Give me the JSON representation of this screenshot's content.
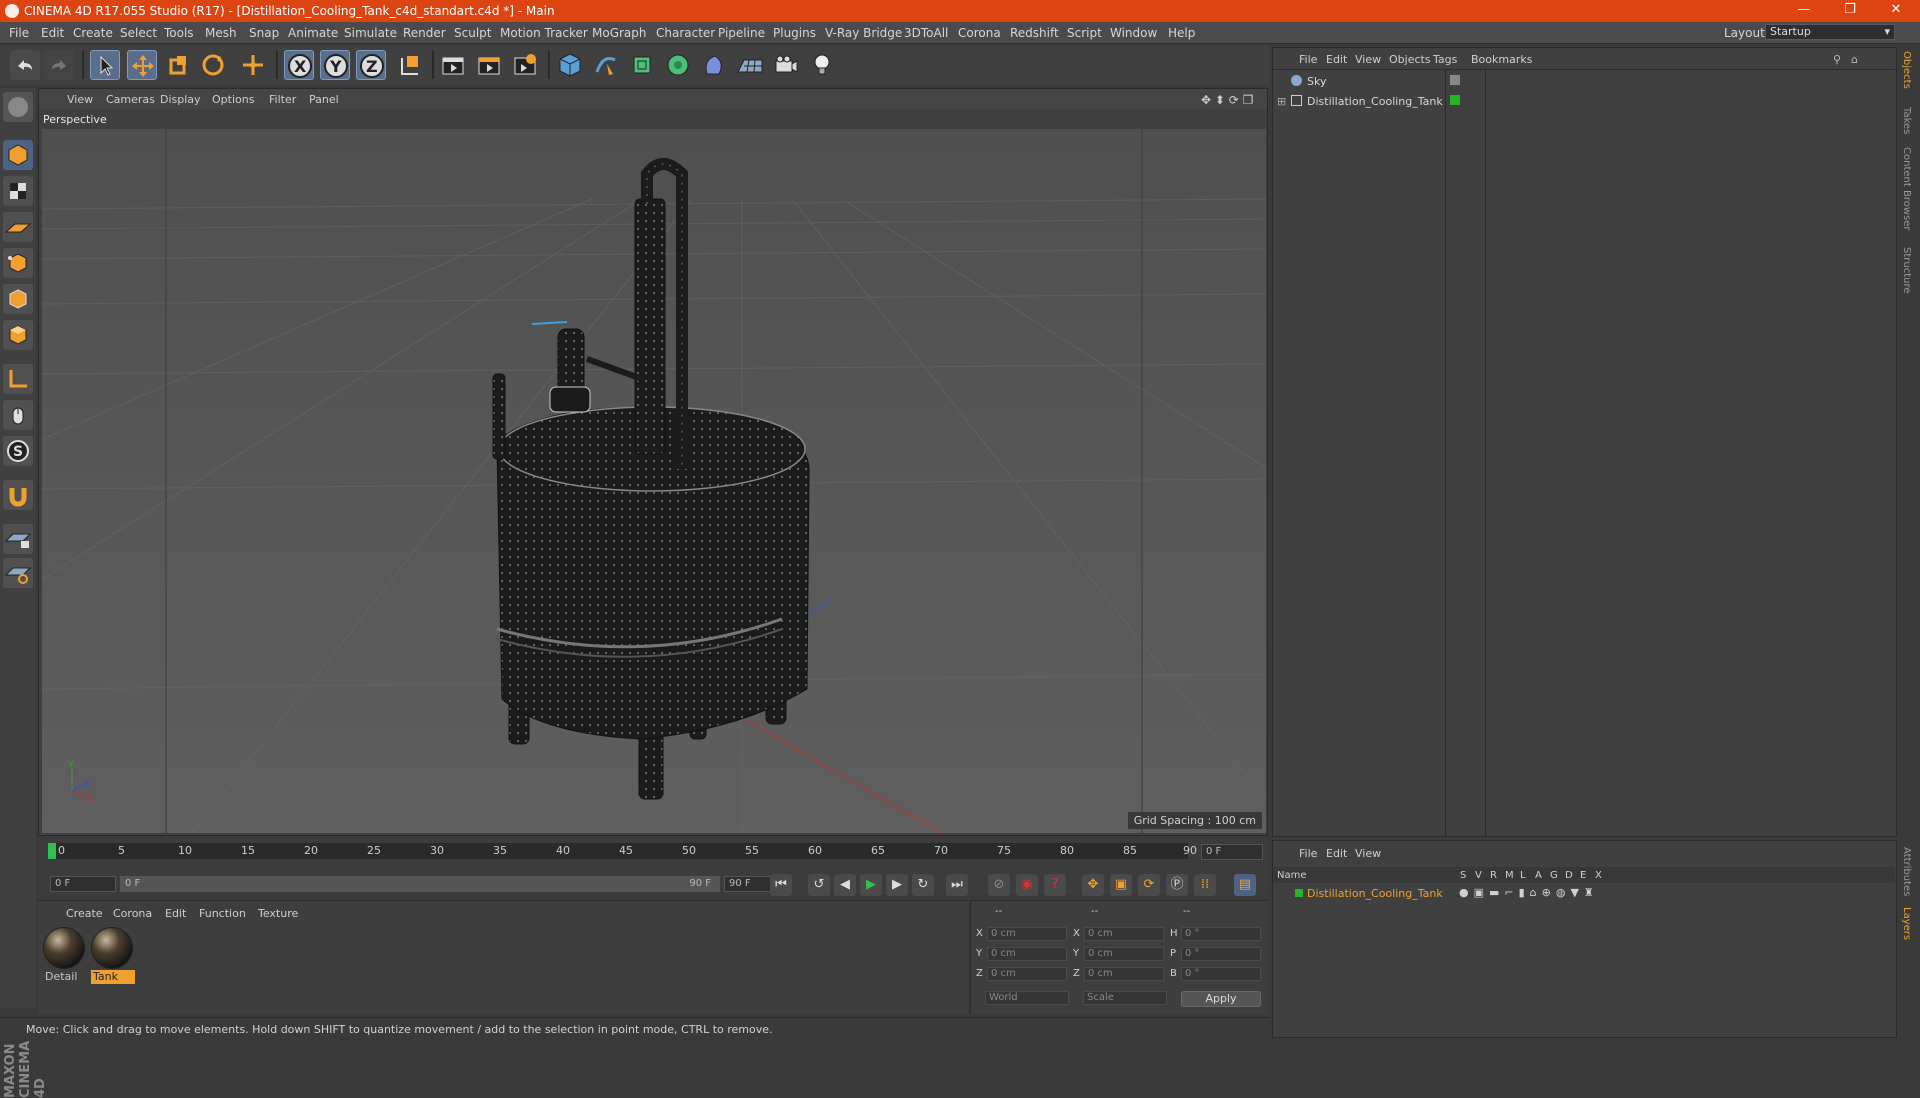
{
  "window": {
    "title": "CINEMA 4D R17.055 Studio (R17) - [Distillation_Cooling_Tank_c4d_standart.c4d *] - Main",
    "minimize": "—",
    "restore": "❐",
    "close": "✕"
  },
  "menu": [
    "File",
    "Edit",
    "Create",
    "Select",
    "Tools",
    "Mesh",
    "Snap",
    "Animate",
    "Simulate",
    "Render",
    "Sculpt",
    "Motion Tracker",
    "MoGraph",
    "Character",
    "Pipeline",
    "Plugins",
    "V-Ray Bridge",
    "3DToAll",
    "Corona",
    "Redshift",
    "Script",
    "Window",
    "Help"
  ],
  "layout": {
    "label": "Layout:",
    "value": "Startup"
  },
  "viewport": {
    "menu": [
      "View",
      "Cameras",
      "Display",
      "Options",
      "Filter",
      "Panel"
    ],
    "camera": "Perspective",
    "grid_spacing": "Grid Spacing : 100 cm"
  },
  "timeline": {
    "ticks": [
      "0",
      "5",
      "10",
      "15",
      "20",
      "25",
      "30",
      "35",
      "40",
      "45",
      "50",
      "55",
      "60",
      "65",
      "70",
      "75",
      "80",
      "85",
      "90"
    ],
    "current_frame": "0 F",
    "start": "0 F",
    "range_start": "0 F",
    "range_end": "90 F",
    "end": "90 F"
  },
  "materials": {
    "menu": [
      "Create",
      "Corona",
      "Edit",
      "Function",
      "Texture"
    ],
    "items": [
      {
        "name": "Detail",
        "selected": false
      },
      {
        "name": "Tank",
        "selected": true
      }
    ]
  },
  "coords": {
    "headers": [
      "--",
      "--",
      "--"
    ],
    "rows": [
      {
        "a": "X",
        "av": "0 cm",
        "b": "X",
        "bv": "0 cm",
        "c": "H",
        "cv": "0 °"
      },
      {
        "a": "Y",
        "av": "0 cm",
        "b": "Y",
        "bv": "0 cm",
        "c": "P",
        "cv": "0 °"
      },
      {
        "a": "Z",
        "av": "0 cm",
        "b": "Z",
        "bv": "0 cm",
        "c": "B",
        "cv": "0 °"
      }
    ],
    "mode": "World",
    "scale": "Scale",
    "apply": "Apply"
  },
  "objects": {
    "menu": [
      "File",
      "Edit",
      "View",
      "Objects",
      "Tags",
      "Bookmarks"
    ],
    "items": [
      {
        "name": "Sky"
      },
      {
        "name": "Distillation_Cooling_Tank"
      }
    ]
  },
  "layers": {
    "menu": [
      "File",
      "Edit",
      "View"
    ],
    "columns": [
      "Name",
      "S",
      "V",
      "R",
      "M",
      "L",
      "A",
      "G",
      "D",
      "E",
      "X"
    ],
    "items": [
      {
        "name": "Distillation_Cooling_Tank",
        "color": "#28b428"
      }
    ]
  },
  "right_tabs": [
    "Objects",
    "Takes",
    "Content Browser",
    "Structure",
    "Attributes",
    "Layers"
  ],
  "status": "Move: Click and drag to move elements. Hold down SHIFT to quantize movement / add to the selection in point mode, CTRL to remove.",
  "brand": "MAXON CINEMA 4D",
  "colors": {
    "titlebar": "#dc4511",
    "accent": "#f0a030",
    "selection": "#4c6384"
  }
}
